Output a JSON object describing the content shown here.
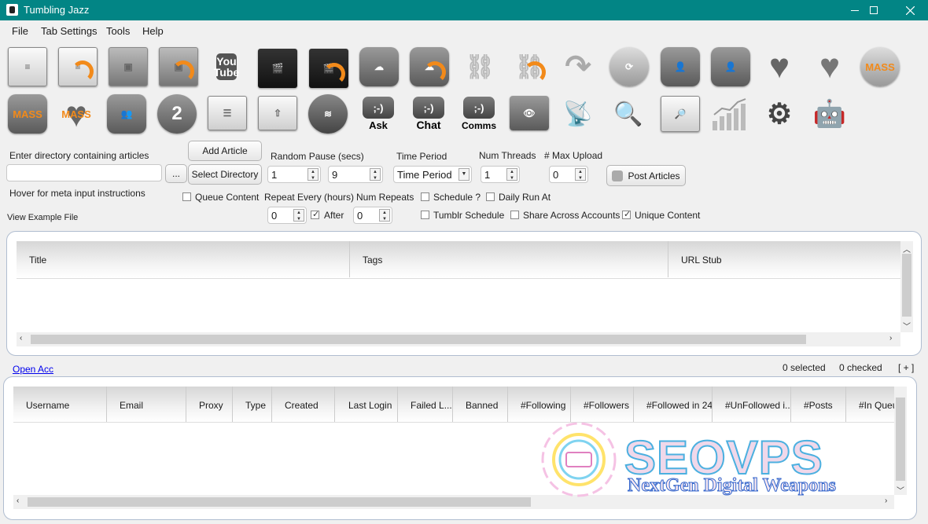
{
  "window": {
    "title": "Tumbling Jazz"
  },
  "menu": [
    "File",
    "Tab Settings",
    "Tools",
    "Help"
  ],
  "toolbar_icons": [
    "notepad-icon",
    "notepad-rss-icon",
    "photo-icon",
    "photo-rss-icon",
    "youtube-icon",
    "clapper-icon",
    "clapper-rss-icon",
    "soundcloud-icon",
    "soundcloud-rss-icon",
    "link-icon",
    "link-rss-icon",
    "reblog-icon",
    "refresh-icon",
    "add-user-icon",
    "remove-user-icon",
    "heart-icon",
    "unlike-heart-icon",
    "mass-refresh-icon",
    "mass-user-icon",
    "mass-heart-icon",
    "add-users-icon",
    "second-user-icon",
    "calendar-icon",
    "upload-calendar-icon",
    "spotify-icon",
    "ask-icon",
    "chat-icon",
    "comms-icon",
    "watch-folder-icon",
    "satellite-icon",
    "search-icon",
    "image-search-icon",
    "stats-chart-icon",
    "gears-icon",
    "robot-icon"
  ],
  "toolbar_text": {
    "mass": "MASS",
    "youtube": "You",
    "youtube2": "Tube",
    "bubble": ";-)",
    "ask": "Ask",
    "chat": "Chat",
    "comms": "Comms",
    "two": "2"
  },
  "form": {
    "dir_label": "Enter directory containing articles",
    "dir_value": "",
    "browse_label": "...",
    "hover_label": "Hover for meta input instructions",
    "example_label": "View Example File",
    "add_article": "Add Article",
    "select_directory": "Select Directory",
    "random_pause_label": "Random Pause (secs)",
    "pause_min": "1",
    "pause_max": "9",
    "time_period_label": "Time Period",
    "time_period_value": "Time Period",
    "num_threads_label": "Num Threads",
    "num_threads_value": "1",
    "max_upload_label": "# Max Upload",
    "max_upload_value": "0",
    "post_articles": "Post Articles",
    "queue_content": "Queue Content",
    "repeat_every_label": "Repeat Every (hours)",
    "repeat_value": "0",
    "after_label": "After",
    "num_repeats_label": "Num Repeats",
    "num_repeats_value": "0",
    "schedule_label": "Schedule ?",
    "daily_run_label": "Daily Run At",
    "tumblr_schedule": "Tumblr Schedule",
    "share_across": "Share Across Accounts",
    "unique_content": "Unique Content"
  },
  "articles_table": {
    "columns": [
      "Title",
      "Tags",
      "URL Stub"
    ]
  },
  "accounts_bar": {
    "open_acc": "Open Acc",
    "selected": "0 selected",
    "checked": "0 checked",
    "expand": "[ + ]"
  },
  "accounts_table": {
    "columns": [
      "Username",
      "Email",
      "Proxy",
      "Type",
      "Created",
      "Last Login",
      "Failed L...",
      "Banned",
      "#Following",
      "#Followers",
      "#Followed in 24",
      "#UnFollowed i...",
      "#Posts",
      "#In Queu"
    ]
  },
  "watermark": {
    "title": "SEOVPS",
    "subtitle": "NextGen Digital Weapons"
  },
  "colors": {
    "titlebar": "#028585",
    "link": "#0000ee",
    "rss": "#f28a1a",
    "panel_border": "#b0bdd0"
  }
}
